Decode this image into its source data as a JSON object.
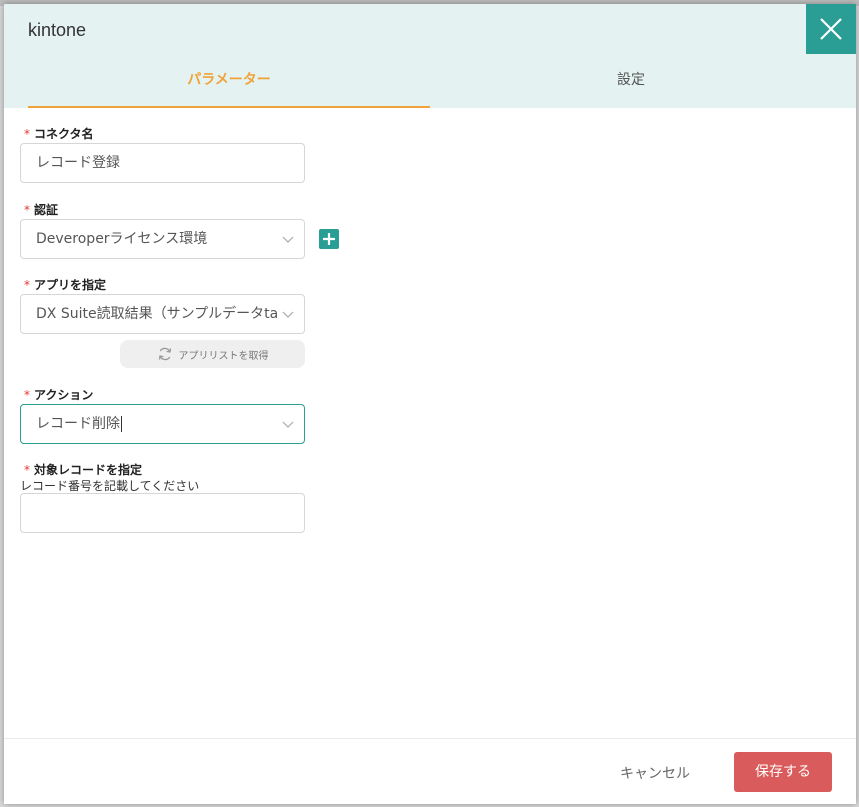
{
  "modal": {
    "title": "kintone",
    "close_icon": "close-icon"
  },
  "tabs": [
    {
      "label": "パラメーター",
      "active": true
    },
    {
      "label": "設定",
      "active": false
    }
  ],
  "fields": {
    "connector_name": {
      "label": "コネクタ名",
      "value": "レコード登録",
      "required": "*"
    },
    "auth": {
      "label": "認証",
      "value": "Deveroperライセンス環境",
      "required": "*"
    },
    "app": {
      "label": "アプリを指定",
      "value": "DX Suite読取結果（サンプルデータta",
      "required": "*"
    },
    "fetch_apps": {
      "label": "アプリリストを取得",
      "icon": "refresh-icon"
    },
    "action": {
      "label": "アクション",
      "value": "レコード削除",
      "required": "*"
    },
    "target_record": {
      "label": "対象レコードを指定",
      "hint": "レコード番号を記載してください",
      "value": "",
      "required": "*"
    }
  },
  "footer": {
    "cancel_label": "キャンセル",
    "save_label": "保存する"
  },
  "colors": {
    "accent": "#2a9d95",
    "tab_active": "#f0a33a",
    "save": "#d95b5b",
    "required": "#e53935",
    "header_bg": "#e4f2f1"
  }
}
